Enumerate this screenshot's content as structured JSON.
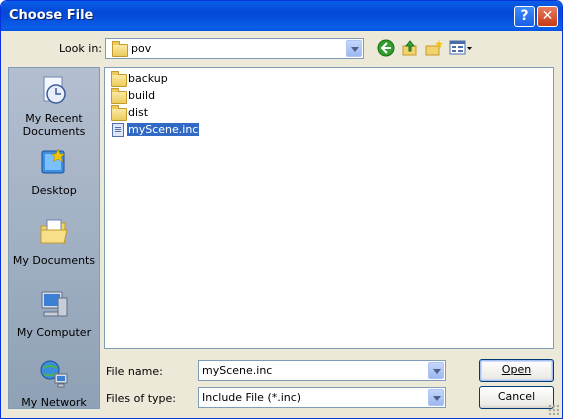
{
  "window": {
    "title": "Choose File",
    "help_symbol": "?",
    "close_symbol": "✕"
  },
  "toolbar": {
    "lookin_label": "Look in:",
    "lookin_value": "pov",
    "icons": [
      "back-icon",
      "up-folder-icon",
      "new-folder-icon",
      "view-menu-icon"
    ]
  },
  "places": [
    {
      "label": "My Recent Documents",
      "icon": "recent-documents-icon"
    },
    {
      "label": "Desktop",
      "icon": "desktop-icon"
    },
    {
      "label": "My Documents",
      "icon": "my-documents-icon"
    },
    {
      "label": "My Computer",
      "icon": "my-computer-icon"
    },
    {
      "label": "My Network",
      "icon": "my-network-icon"
    }
  ],
  "files": [
    {
      "name": "backup",
      "type": "folder"
    },
    {
      "name": "build",
      "type": "folder"
    },
    {
      "name": "dist",
      "type": "folder"
    },
    {
      "name": "myScene.inc",
      "type": "file",
      "selected": true
    }
  ],
  "form": {
    "filename_label": "File name:",
    "filename_value": "myScene.inc",
    "filetype_label": "Files of type:",
    "filetype_value": "Include File (*.inc)"
  },
  "buttons": {
    "open": "Open",
    "cancel": "Cancel"
  },
  "colors": {
    "titlebar": "#0a5ee8",
    "selection": "#316ac5",
    "dialog_bg": "#ece9d8"
  }
}
